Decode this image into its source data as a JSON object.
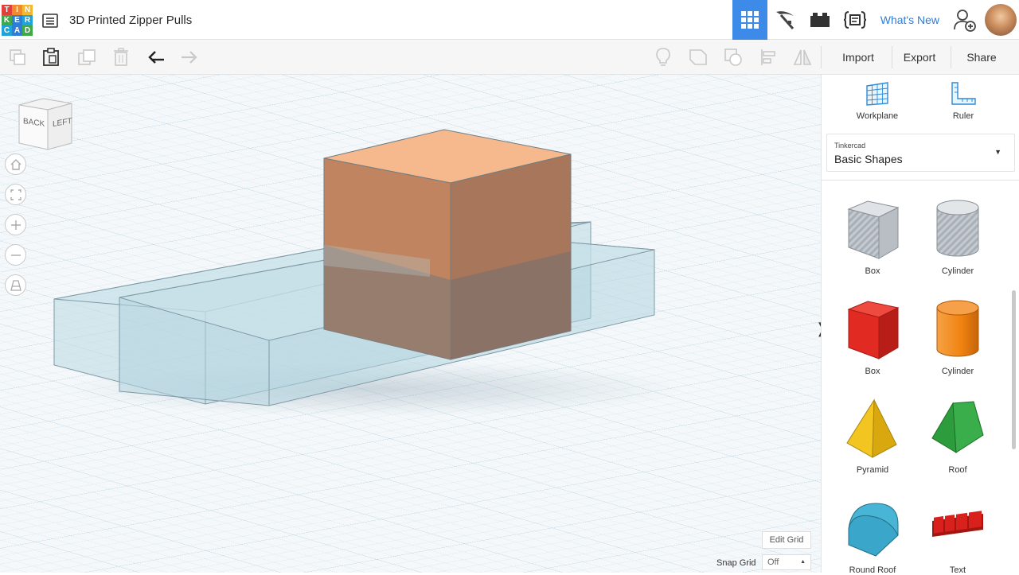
{
  "app": {
    "logo_letters": [
      "T",
      "I",
      "N",
      "K",
      "E",
      "R",
      "C",
      "A",
      "D"
    ],
    "logo_colors": [
      "#e2403d",
      "#f2892b",
      "#f2b830",
      "#3fa949",
      "#2f7dd6",
      "#1fa3d9",
      "#1fa3d9",
      "#2f7dd6",
      "#3fa949"
    ],
    "title": "3D Printed Zipper Pulls"
  },
  "topnav": {
    "items": [
      {
        "name": "3d-view-grid-icon",
        "active": true
      },
      {
        "name": "pickaxe-icon",
        "active": false
      },
      {
        "name": "bricks-icon",
        "active": false
      },
      {
        "name": "codeblocks-icon",
        "active": false
      }
    ],
    "whats_new": "What's New",
    "accent": "#3d8ae8"
  },
  "toolbar": {
    "import_label": "Import",
    "export_label": "Export",
    "share_label": "Share"
  },
  "viewport": {
    "viewcube_back": "BACK",
    "viewcube_left": "LEFT",
    "edit_grid_label": "Edit Grid",
    "snap_grid_label": "Snap Grid",
    "snap_grid_value": "Off"
  },
  "panel": {
    "workplane_label": "Workplane",
    "ruler_label": "Ruler",
    "library_source": "Tinkercad",
    "library_name": "Basic Shapes",
    "shapes": [
      {
        "label": "Box",
        "style": "hole",
        "color": "#b9bec4"
      },
      {
        "label": "Cylinder",
        "style": "hole",
        "color": "#b9bec4"
      },
      {
        "label": "Box",
        "style": "solid",
        "color": "#e02a22"
      },
      {
        "label": "Cylinder",
        "style": "solid",
        "color": "#f0820f"
      },
      {
        "label": "Pyramid",
        "style": "solid",
        "color": "#f2c521"
      },
      {
        "label": "Roof",
        "style": "solid",
        "color": "#2d9c3c"
      },
      {
        "label": "Round Roof",
        "style": "solid",
        "color": "#3aa6c9"
      },
      {
        "label": "Text",
        "style": "solid",
        "color": "#d8201d"
      }
    ]
  }
}
